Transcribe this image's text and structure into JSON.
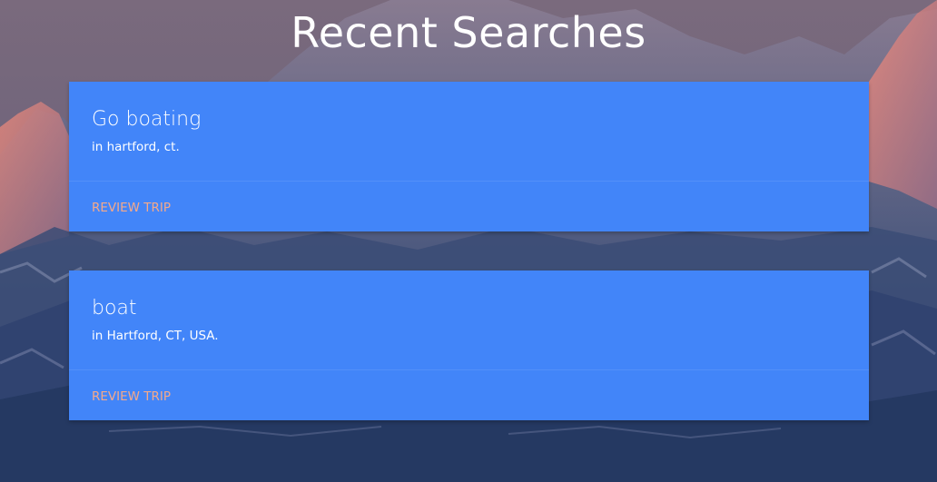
{
  "page": {
    "title": "Recent Searches"
  },
  "searches": [
    {
      "title": "Go boating",
      "subtitle": "in hartford, ct.",
      "action_label": "REVIEW TRIP"
    },
    {
      "title": "boat",
      "subtitle": "in Hartford, CT, USA.",
      "action_label": "REVIEW TRIP"
    }
  ],
  "colors": {
    "card": "#4285f9",
    "action_link": "#f5a98a",
    "title_text": "#ffffff"
  }
}
